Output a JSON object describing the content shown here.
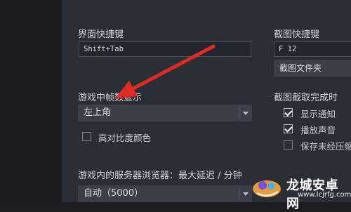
{
  "in_game_shortcut": {
    "label": "界面快捷键",
    "value": "Shift+Tab"
  },
  "screenshot_shortcut": {
    "label": "截图快捷键",
    "value": "F 12",
    "folder_button": "截图文件夹"
  },
  "fps_display": {
    "label": "游戏中帧数显示",
    "selected": "左上角"
  },
  "high_contrast": {
    "label": "高对比度颜色",
    "checked": false
  },
  "on_screenshot": {
    "label": "截图截取完成时",
    "options": [
      {
        "label": "显示通知",
        "checked": true
      },
      {
        "label": "播放声音",
        "checked": true
      },
      {
        "label": "保存未经压缩",
        "checked": false
      }
    ]
  },
  "server_browser": {
    "label": "游戏内的服务器浏览器：最大延迟 / 分钟",
    "selected": "自动（5000）"
  },
  "watermark": {
    "title": "龙城安卓网",
    "url": "www.lcjrfg.com"
  },
  "colors": {
    "panel": "#2a2e35",
    "sidebar": "#1b1d21",
    "arrow": "#e02b22"
  }
}
